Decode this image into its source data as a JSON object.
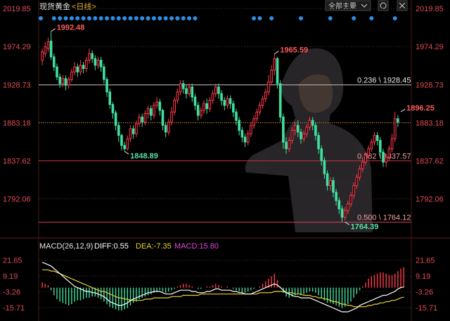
{
  "header": {
    "title": "现货黄金",
    "period": "<日线>",
    "dropdown_label": "全部主要"
  },
  "colors": {
    "up": "#ff3a4a",
    "down": "#41e0a0",
    "axis_label": "#e14b55",
    "diff_line": "#ffffff",
    "dea_line": "#e8d23a",
    "dot": "#2f8de4"
  },
  "icons": [
    "chevron-down-icon",
    "settings-icon",
    "close-icon"
  ],
  "chart_data": [
    {
      "type": "candlestick",
      "y_ticks": [
        "2019.85",
        "1974.29",
        "1928.73",
        "1883.18",
        "1837.62",
        "1792.06"
      ],
      "ylim": [
        1752,
        2020
      ],
      "levels": [
        {
          "value": 1928.45,
          "label": "0.236 \\ 1928.45"
        },
        {
          "value": 1837.57,
          "label": "0.382 \\ 1837.57"
        },
        {
          "value": 1764.12,
          "label": "0.500 \\ 1764.12"
        }
      ],
      "current_price": 1883.18,
      "annotations": [
        {
          "text": "1992.48",
          "value": 1992.48,
          "kind": "high",
          "index": 3
        },
        {
          "text": "1965.59",
          "value": 1965.59,
          "kind": "high",
          "index": 79
        },
        {
          "text": "1896.25",
          "value": 1896.25,
          "kind": "high",
          "index": 122
        },
        {
          "text": "1848.89",
          "value": 1848.89,
          "kind": "low",
          "index": 28
        },
        {
          "text": "1764.39",
          "value": 1764.39,
          "kind": "low",
          "index": 103
        }
      ],
      "candles": [
        [
          1958,
          1968,
          1952,
          1972
        ],
        [
          1966,
          1974,
          1962,
          1980
        ],
        [
          1972,
          1980,
          1968,
          1985
        ],
        [
          1981,
          1962,
          1958,
          1992.48
        ],
        [
          1962,
          1950,
          1945,
          1966
        ],
        [
          1950,
          1938,
          1934,
          1954
        ],
        [
          1938,
          1930,
          1925,
          1942
        ],
        [
          1930,
          1936,
          1926,
          1940
        ],
        [
          1936,
          1928,
          1922,
          1940
        ],
        [
          1928,
          1935,
          1924,
          1938
        ],
        [
          1935,
          1944,
          1932,
          1948
        ],
        [
          1944,
          1950,
          1940,
          1956
        ],
        [
          1950,
          1944,
          1938,
          1954
        ],
        [
          1944,
          1952,
          1940,
          1958
        ],
        [
          1952,
          1948,
          1942,
          1956
        ],
        [
          1948,
          1958,
          1944,
          1962
        ],
        [
          1958,
          1966,
          1954,
          1972
        ],
        [
          1966,
          1960,
          1955,
          1970
        ],
        [
          1960,
          1952,
          1946,
          1964
        ],
        [
          1952,
          1958,
          1948,
          1962
        ],
        [
          1958,
          1950,
          1944,
          1962
        ],
        [
          1950,
          1935,
          1930,
          1954
        ],
        [
          1935,
          1920,
          1914,
          1938
        ],
        [
          1920,
          1905,
          1900,
          1924
        ],
        [
          1905,
          1895,
          1888,
          1908
        ],
        [
          1895,
          1880,
          1874,
          1898
        ],
        [
          1880,
          1868,
          1860,
          1884
        ],
        [
          1868,
          1856,
          1850,
          1870
        ],
        [
          1856,
          1852,
          1848.89,
          1860
        ],
        [
          1852,
          1864,
          1850,
          1868
        ],
        [
          1864,
          1876,
          1860,
          1880
        ],
        [
          1876,
          1870,
          1864,
          1880
        ],
        [
          1870,
          1882,
          1866,
          1886
        ],
        [
          1882,
          1890,
          1878,
          1894
        ],
        [
          1890,
          1884,
          1878,
          1894
        ],
        [
          1884,
          1894,
          1880,
          1898
        ],
        [
          1894,
          1900,
          1888,
          1904
        ],
        [
          1900,
          1892,
          1886,
          1904
        ],
        [
          1892,
          1904,
          1888,
          1908
        ],
        [
          1904,
          1908,
          1900,
          1914
        ],
        [
          1908,
          1898,
          1892,
          1912
        ],
        [
          1898,
          1880,
          1874,
          1900
        ],
        [
          1880,
          1872,
          1866,
          1884
        ],
        [
          1872,
          1884,
          1868,
          1888
        ],
        [
          1884,
          1896,
          1880,
          1902
        ],
        [
          1896,
          1910,
          1892,
          1914
        ],
        [
          1910,
          1920,
          1906,
          1924
        ],
        [
          1920,
          1930,
          1916,
          1934
        ],
        [
          1930,
          1924,
          1918,
          1934
        ],
        [
          1924,
          1918,
          1912,
          1928
        ],
        [
          1918,
          1926,
          1914,
          1930
        ],
        [
          1926,
          1914,
          1908,
          1930
        ],
        [
          1914,
          1904,
          1898,
          1918
        ],
        [
          1904,
          1892,
          1886,
          1908
        ],
        [
          1892,
          1898,
          1888,
          1902
        ],
        [
          1898,
          1906,
          1894,
          1910
        ],
        [
          1906,
          1900,
          1894,
          1912
        ],
        [
          1900,
          1910,
          1896,
          1914
        ],
        [
          1910,
          1918,
          1906,
          1922
        ],
        [
          1918,
          1926,
          1914,
          1930
        ],
        [
          1926,
          1918,
          1912,
          1930
        ],
        [
          1918,
          1910,
          1904,
          1922
        ],
        [
          1910,
          1904,
          1898,
          1914
        ],
        [
          1904,
          1912,
          1900,
          1916
        ],
        [
          1912,
          1906,
          1900,
          1916
        ],
        [
          1906,
          1896,
          1890,
          1910
        ],
        [
          1896,
          1886,
          1880,
          1900
        ],
        [
          1886,
          1874,
          1868,
          1890
        ],
        [
          1874,
          1866,
          1860,
          1878
        ],
        [
          1866,
          1860,
          1854,
          1870
        ],
        [
          1860,
          1870,
          1856,
          1874
        ],
        [
          1870,
          1880,
          1866,
          1884
        ],
        [
          1880,
          1888,
          1876,
          1892
        ],
        [
          1888,
          1896,
          1884,
          1900
        ],
        [
          1896,
          1904,
          1892,
          1908
        ],
        [
          1904,
          1912,
          1900,
          1916
        ],
        [
          1912,
          1920,
          1908,
          1924
        ],
        [
          1920,
          1932,
          1916,
          1940
        ],
        [
          1932,
          1946,
          1928,
          1952
        ],
        [
          1946,
          1960,
          1940,
          1965.59
        ],
        [
          1960,
          1930,
          1924,
          1962
        ],
        [
          1930,
          1890,
          1884,
          1934
        ],
        [
          1890,
          1860,
          1852,
          1894
        ],
        [
          1860,
          1852,
          1846,
          1866
        ],
        [
          1852,
          1862,
          1848,
          1866
        ],
        [
          1862,
          1874,
          1858,
          1878
        ],
        [
          1874,
          1880,
          1868,
          1884
        ],
        [
          1880,
          1872,
          1866,
          1886
        ],
        [
          1872,
          1864,
          1858,
          1876
        ],
        [
          1864,
          1870,
          1860,
          1874
        ],
        [
          1870,
          1878,
          1866,
          1882
        ],
        [
          1878,
          1886,
          1874,
          1890
        ],
        [
          1886,
          1880,
          1874,
          1890
        ],
        [
          1880,
          1868,
          1862,
          1884
        ],
        [
          1868,
          1852,
          1846,
          1872
        ],
        [
          1852,
          1838,
          1832,
          1856
        ],
        [
          1838,
          1822,
          1816,
          1842
        ],
        [
          1822,
          1808,
          1802,
          1826
        ],
        [
          1808,
          1814,
          1802,
          1818
        ],
        [
          1814,
          1800,
          1794,
          1818
        ],
        [
          1800,
          1790,
          1784,
          1804
        ],
        [
          1790,
          1780,
          1774,
          1794
        ],
        [
          1780,
          1770,
          1764.39,
          1784
        ],
        [
          1770,
          1778,
          1766,
          1782
        ],
        [
          1778,
          1786,
          1774,
          1790
        ],
        [
          1786,
          1796,
          1782,
          1800
        ],
        [
          1796,
          1808,
          1792,
          1812
        ],
        [
          1808,
          1818,
          1804,
          1822
        ],
        [
          1818,
          1828,
          1814,
          1832
        ],
        [
          1828,
          1836,
          1824,
          1840
        ],
        [
          1836,
          1844,
          1832,
          1848
        ],
        [
          1844,
          1852,
          1840,
          1856
        ],
        [
          1852,
          1860,
          1848,
          1864
        ],
        [
          1860,
          1868,
          1856,
          1872
        ],
        [
          1868,
          1862,
          1856,
          1872
        ],
        [
          1862,
          1848,
          1840,
          1866
        ],
        [
          1848,
          1836,
          1830,
          1852
        ],
        [
          1836,
          1842,
          1830,
          1846
        ],
        [
          1842,
          1852,
          1838,
          1856
        ],
        [
          1852,
          1864,
          1848,
          1870
        ],
        [
          1864,
          1888,
          1860,
          1896.25
        ],
        [
          1888,
          1884,
          1878,
          1892
        ]
      ]
    },
    {
      "type": "macd",
      "header": {
        "label": "MACD(26,12,9)",
        "diff": "DIFF:0.55",
        "dea": "DEA:-7.35",
        "macd": "MACD:15.80"
      },
      "y_ticks": [
        "21.65",
        "9.19",
        "-3.26",
        "-15.71"
      ],
      "ylim": [
        -24,
        28
      ],
      "histogram": [
        4,
        3,
        2,
        -2,
        -6,
        -9,
        -11,
        -12,
        -13,
        -14,
        -13,
        -11,
        -10,
        -10,
        -9,
        -8,
        -8,
        -7,
        -7,
        -8,
        -9,
        -11,
        -13,
        -15,
        -16,
        -17,
        -18,
        -18,
        -17,
        -16,
        -14,
        -12,
        -11,
        -9,
        -8,
        -7,
        -6,
        -5,
        -4,
        -3,
        -2,
        -3,
        -4,
        -3,
        -2,
        -1,
        1,
        2,
        3,
        3,
        2,
        1,
        0,
        -1,
        -1,
        0,
        1,
        1,
        2,
        3,
        2,
        1,
        0,
        1,
        0,
        -1,
        -2,
        -3,
        -4,
        -4,
        -3,
        -2,
        -1,
        0,
        1,
        3,
        5,
        7,
        9,
        11,
        6,
        1,
        -4,
        -7,
        -8,
        -7,
        -6,
        -5,
        -6,
        -5,
        -4,
        -3,
        -3,
        -4,
        -6,
        -8,
        -10,
        -12,
        -12,
        -13,
        -14,
        -15,
        -16,
        -15,
        -13,
        -11,
        -8,
        -5,
        -2,
        1,
        4,
        7,
        9,
        10,
        11,
        12,
        12,
        11,
        10,
        10,
        11,
        13,
        15,
        16
      ],
      "diff": [
        20,
        19,
        18,
        17,
        15,
        13,
        11,
        9,
        7,
        5,
        3,
        1,
        0,
        -1,
        -2,
        -3,
        -3,
        -4,
        -4,
        -5,
        -6,
        -7,
        -9,
        -11,
        -12,
        -13,
        -14,
        -14,
        -13,
        -12,
        -10,
        -9,
        -8,
        -7,
        -6,
        -5,
        -4,
        -4,
        -3,
        -3,
        -3,
        -4,
        -5,
        -5,
        -5,
        -4,
        -3,
        -2,
        -2,
        -2,
        -2,
        -3,
        -3,
        -4,
        -4,
        -4,
        -3,
        -3,
        -2,
        -1,
        -1,
        -2,
        -2,
        -2,
        -2,
        -3,
        -3,
        -4,
        -4,
        -5,
        -5,
        -5,
        -4,
        -3,
        -2,
        -1,
        0,
        1,
        2,
        3,
        2,
        0,
        -2,
        -4,
        -5,
        -6,
        -7,
        -7,
        -8,
        -8,
        -8,
        -8,
        -9,
        -10,
        -11,
        -12,
        -13,
        -14,
        -15,
        -16,
        -17,
        -18,
        -19,
        -19,
        -19,
        -18,
        -17,
        -16,
        -14,
        -13,
        -12,
        -11,
        -10,
        -9,
        -8,
        -7,
        -6,
        -6,
        -5,
        -4,
        -3,
        -1,
        0,
        0.55
      ],
      "dea": [
        14,
        14,
        14,
        13,
        13,
        12,
        11,
        10,
        9,
        8,
        7,
        6,
        5,
        4,
        3,
        2,
        1,
        0,
        -1,
        -2,
        -3,
        -3,
        -4,
        -5,
        -6,
        -7,
        -8,
        -8,
        -9,
        -9,
        -10,
        -10,
        -10,
        -10,
        -10,
        -9,
        -9,
        -9,
        -8,
        -8,
        -8,
        -8,
        -8,
        -8,
        -7,
        -7,
        -7,
        -7,
        -6,
        -6,
        -6,
        -6,
        -6,
        -6,
        -5,
        -5,
        -5,
        -5,
        -5,
        -5,
        -5,
        -5,
        -5,
        -5,
        -5,
        -5,
        -5,
        -5,
        -5,
        -5,
        -5,
        -5,
        -5,
        -5,
        -4,
        -4,
        -4,
        -4,
        -4,
        -3,
        -3,
        -3,
        -3,
        -4,
        -4,
        -4,
        -5,
        -5,
        -5,
        -6,
        -6,
        -6,
        -7,
        -7,
        -8,
        -8,
        -9,
        -9,
        -10,
        -11,
        -11,
        -12,
        -13,
        -13,
        -14,
        -14,
        -15,
        -15,
        -15,
        -15,
        -15,
        -14,
        -14,
        -13,
        -13,
        -12,
        -12,
        -11,
        -11,
        -10,
        -10,
        -9,
        -8,
        -7.35
      ]
    }
  ]
}
